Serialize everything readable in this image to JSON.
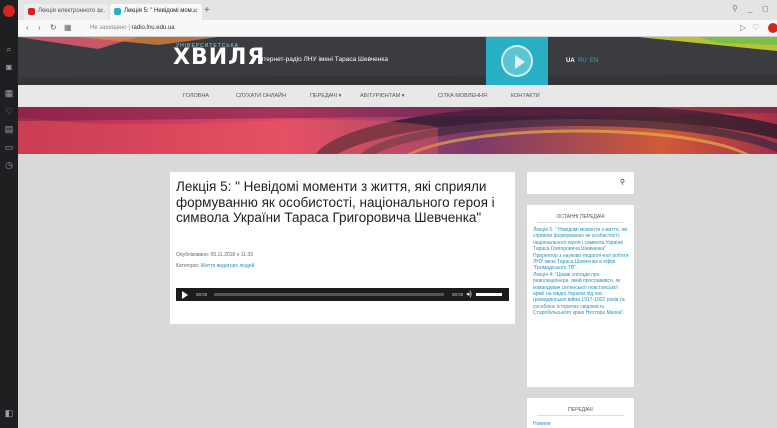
{
  "browser": {
    "tabs": [
      {
        "label": "Лекція електронного з…",
        "active": false
      },
      {
        "label": "Лекція 5: \" Невідомі мом…",
        "active": true
      }
    ],
    "new_tab": "+",
    "address": {
      "security": "Не захищено",
      "url": "radio.lnu.edu.ua"
    }
  },
  "site": {
    "logo_top": "УНІВЕРСИТЕТСЬКА",
    "logo": "ХВИЛЯ",
    "tagline": "Інтернет-радіо ЛНУ імені Тараса Шевченка",
    "languages": [
      "UA",
      "RU",
      "EN"
    ],
    "nav": [
      "ГОЛОВНА",
      "СЛУХАТИ ОНЛАЙН",
      "ПЕРЕДАЧІ ▾",
      "АБІТУРІЄНТАМ ▾",
      "СІТКА МОВЛЕННЯ",
      "КОНТАКТИ"
    ]
  },
  "article": {
    "title": "Лекція 5: \" Невідомі моменти з життя, які сприяли формуванню як особистості, національного героя і символа України Тараса Григоровича Шевченка\"",
    "published": "Опубліковано: 05.11.2018 о 11:33",
    "category_label": "Категорія:",
    "category": "Життя видатних людей",
    "player": {
      "time_start": "00:00",
      "time_end": "00:00"
    }
  },
  "sidebar": {
    "recent_title": "ОСТАННІ ПЕРЕДАЧІ",
    "recent_items": [
      "Лекція 5: \" Невідомі моменти з життя, які сприяли формуванню як особистості, національного героя і символа України Тараса Григоровича Шевченка\"",
      "Проректор з науково-педагогічної роботи ЛНУ імені Тараса Шевченка в ефірі \"Громадського ТВ\".",
      "Лекція 4: \"Цікаві спогади про революціонера, який прославився, як командувач селянської повстанської армії на півдні України під час громадянської війни 1917-1922 років та уособлює історичну свідомість Старобільського краю Нестора Махна\"."
    ],
    "shows_title": "ПЕРЕДАЧІ",
    "shows_items": [
      "Новини"
    ]
  },
  "colors": {
    "accent": "#27b0c4",
    "link": "#2a8fbf",
    "header": "#3b3c40",
    "browser_red": "#d8251c"
  }
}
